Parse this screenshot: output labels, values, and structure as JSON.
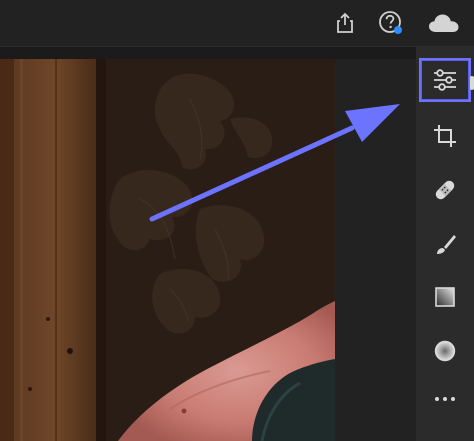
{
  "topbar": {
    "icons": [
      "share-icon",
      "help-icon",
      "cloud-icon"
    ],
    "help_badge_color": "#2d8cff"
  },
  "canvas": {
    "content": "photo",
    "accent_color": "#6b73ff"
  },
  "toolrail": {
    "tools": [
      {
        "id": "edit",
        "icon": "sliders-icon",
        "active": true
      },
      {
        "id": "crop",
        "icon": "crop-icon",
        "active": false
      },
      {
        "id": "heal",
        "icon": "bandage-icon",
        "active": false
      },
      {
        "id": "brush",
        "icon": "brush-icon",
        "active": false
      },
      {
        "id": "linear-gradient",
        "icon": "linear-gradient-icon",
        "active": false
      },
      {
        "id": "radial-gradient",
        "icon": "radial-gradient-icon",
        "active": false
      },
      {
        "id": "more",
        "icon": "more-icon",
        "active": false
      }
    ]
  }
}
